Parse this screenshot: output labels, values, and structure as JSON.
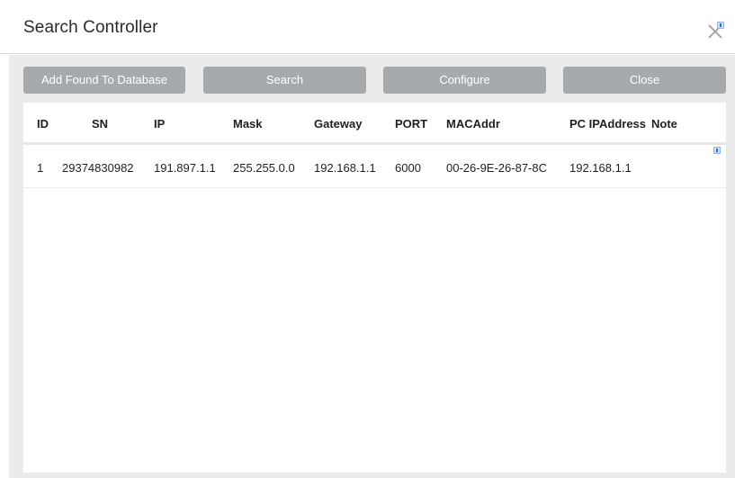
{
  "dialog": {
    "title": "Search Controller"
  },
  "toolbar": {
    "add_found_label": "Add Found To Database",
    "search_label": "Search",
    "configure_label": "Configure",
    "close_label": "Close"
  },
  "table": {
    "columns": [
      "ID",
      "SN",
      "IP",
      "Mask",
      "Gateway",
      "PORT",
      "MACAddr",
      "PC IPAddress",
      "Note"
    ],
    "rows": [
      {
        "id": "1",
        "sn": "29374830982",
        "ip": "191.897.1.1",
        "mask": "255.255.0.0",
        "gateway": "192.168.1.1",
        "port": "6000",
        "macaddr": "00-26-9E-26-87-8C",
        "pc_ipaddress": "192.168.1.1",
        "note": ""
      }
    ]
  },
  "icons": {
    "close": "close-icon",
    "marker": "marker-icon"
  },
  "colors": {
    "button_bg": "#a7aaad",
    "body_bg": "#ebebeb",
    "header_border": "#e6e6e6"
  }
}
